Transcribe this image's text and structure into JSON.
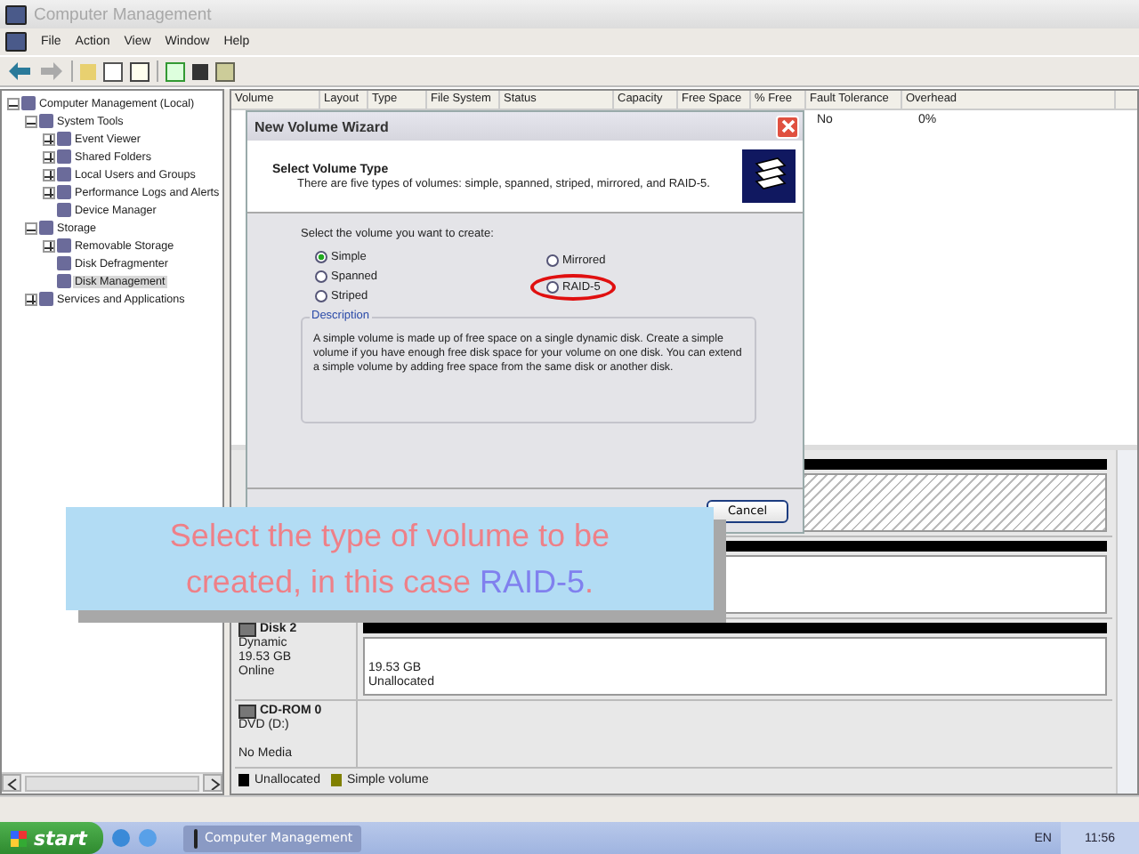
{
  "window": {
    "title": "Computer Management"
  },
  "menu": [
    "File",
    "Action",
    "View",
    "Window",
    "Help"
  ],
  "tree": [
    {
      "label": "Computer Management (Local)",
      "expanded": true,
      "selected": false,
      "children": [
        {
          "label": "System Tools",
          "expanded": true,
          "selected": false,
          "children": [
            {
              "label": "Event Viewer",
              "expanded": false,
              "selected": false
            },
            {
              "label": "Shared Folders",
              "expanded": false,
              "selected": false
            },
            {
              "label": "Local Users and Groups",
              "expanded": false,
              "selected": false
            },
            {
              "label": "Performance Logs and Alerts",
              "expanded": false,
              "selected": false
            },
            {
              "label": "Device Manager",
              "selected": false
            }
          ]
        },
        {
          "label": "Storage",
          "expanded": true,
          "selected": false,
          "children": [
            {
              "label": "Removable Storage",
              "expanded": false,
              "selected": false
            },
            {
              "label": "Disk Defragmenter",
              "selected": false
            },
            {
              "label": "Disk Management",
              "selected": true
            }
          ]
        },
        {
          "label": "Services and Applications",
          "expanded": false,
          "selected": false
        }
      ]
    }
  ],
  "volume_table": {
    "columns": [
      "Volume",
      "Layout",
      "Type",
      "File System",
      "Status",
      "Capacity",
      "Free Space",
      "% Free",
      "Fault Tolerance",
      "Overhead"
    ],
    "rows": [
      {
        "fault_tolerance": "No",
        "overhead": "0%"
      }
    ]
  },
  "disks": [
    {
      "kind": "hatched"
    },
    {
      "kind": "plain"
    },
    {
      "kind": "dynamic",
      "name": "Disk 2",
      "type": "Dynamic",
      "size": "19.53 GB",
      "status": "Online",
      "region_size": "19.53 GB",
      "region_label": "Unallocated"
    },
    {
      "kind": "cdrom",
      "name": "CD-ROM 0",
      "type": "DVD (D:)",
      "status": "No Media"
    }
  ],
  "legend": [
    {
      "label": "Unallocated",
      "color": "#000000"
    },
    {
      "label": "Simple volume",
      "color": "#808000"
    }
  ],
  "wizard": {
    "title": "New Volume Wizard",
    "heading": "Select Volume Type",
    "subheading": "There are five types of volumes: simple, spanned, striped, mirrored, and RAID-5.",
    "prompt": "Select the volume you want to create:",
    "options": [
      {
        "label": "Simple",
        "selected": true
      },
      {
        "label": "Spanned",
        "selected": false
      },
      {
        "label": "Striped",
        "selected": false
      },
      {
        "label": "Mirrored",
        "selected": false
      },
      {
        "label": "RAID-5",
        "selected": false,
        "circled": true
      }
    ],
    "description_title": "Description",
    "description": "A simple volume is made up of free space on a single dynamic disk. Create a simple volume if you have enough free disk space for your volume on one disk. You can extend a simple volume by adding free space from the same disk or another disk.",
    "buttons": [
      "Cancel"
    ]
  },
  "caption": {
    "parts": [
      {
        "text": "Select the type of volume to be created, in this case ",
        "highlight": false
      },
      {
        "text": "RAID-5",
        "highlight": true
      },
      {
        "text": ".",
        "highlight": false
      }
    ]
  },
  "taskbar": {
    "start": "start",
    "tasks": [
      "Computer Management"
    ],
    "language": "EN",
    "clock": "11:56"
  }
}
